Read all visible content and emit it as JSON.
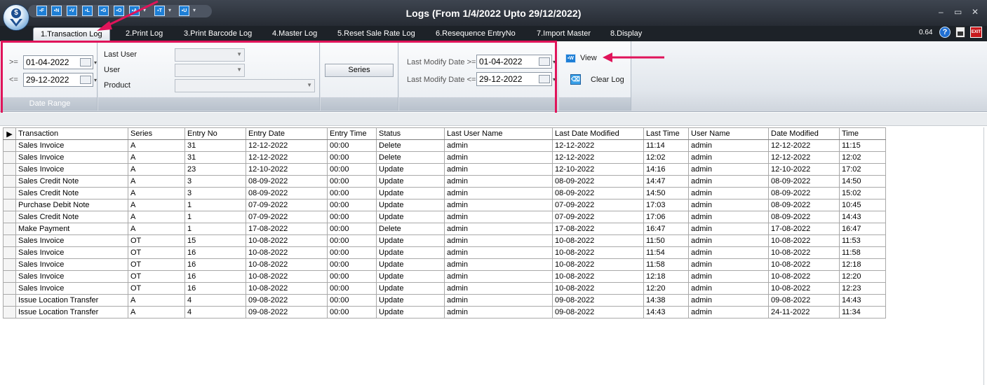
{
  "window": {
    "title": "Logs (From 1/4/2022 Upto 29/12/2022)",
    "minimize": "–",
    "maximize": "▭",
    "close": "✕"
  },
  "quick_access": [
    "▪F",
    "▪N",
    "▪V",
    "▪L",
    "▪G",
    "▪O",
    "▪A",
    "▪T",
    "▪U"
  ],
  "tabs": [
    {
      "label": "1.Transaction Log",
      "active": true
    },
    {
      "label": "2.Print Log"
    },
    {
      "label": "3.Print Barcode Log"
    },
    {
      "label": "4.Master Log"
    },
    {
      "label": "5.Reset Sale Rate Log"
    },
    {
      "label": "6.Resequence EntryNo"
    },
    {
      "label": "7.Import Master"
    },
    {
      "label": "8.Display"
    }
  ],
  "right_tools": {
    "zoom": "0.64",
    "help": "?",
    "exit": "EXIT"
  },
  "ribbon": {
    "date_range": {
      "caption": "Date Range",
      "from_label": ">=",
      "from_value": "01-04-2022",
      "to_label": "<=",
      "to_value": "29-12-2022"
    },
    "filters": {
      "last_user_label": "Last User",
      "user_label": "User",
      "product_label": "Product"
    },
    "series_button": "Series",
    "modify": {
      "from_label": "Last Modify Date >=",
      "from_value": "01-04-2022",
      "to_label": "Last Modify Date <=",
      "to_value": "29-12-2022"
    },
    "actions": {
      "view_label": "View",
      "clear_label": "Clear Log"
    }
  },
  "grid": {
    "columns": [
      "Transaction",
      "Series",
      "Entry No",
      "Entry Date",
      "Entry Time",
      "Status",
      "Last User Name",
      "Last Date Modified",
      "Last Time",
      "User Name",
      "Date Modified",
      "Time"
    ],
    "rows": [
      [
        "Sales Invoice",
        "A",
        "31",
        "12-12-2022",
        "00:00",
        "Delete",
        "admin",
        "12-12-2022",
        "11:14",
        "admin",
        "12-12-2022",
        "11:15"
      ],
      [
        "Sales Invoice",
        "A",
        "31",
        "12-12-2022",
        "00:00",
        "Delete",
        "admin",
        "12-12-2022",
        "12:02",
        "admin",
        "12-12-2022",
        "12:02"
      ],
      [
        "Sales Invoice",
        "A",
        "23",
        "12-10-2022",
        "00:00",
        "Update",
        "admin",
        "12-10-2022",
        "14:16",
        "admin",
        "12-10-2022",
        "17:02"
      ],
      [
        "Sales Credit Note",
        "A",
        "3",
        "08-09-2022",
        "00:00",
        "Update",
        "admin",
        "08-09-2022",
        "14:47",
        "admin",
        "08-09-2022",
        "14:50"
      ],
      [
        "Sales Credit Note",
        "A",
        "3",
        "08-09-2022",
        "00:00",
        "Update",
        "admin",
        "08-09-2022",
        "14:50",
        "admin",
        "08-09-2022",
        "15:02"
      ],
      [
        "Purchase Debit Note",
        "A",
        "1",
        "07-09-2022",
        "00:00",
        "Update",
        "admin",
        "07-09-2022",
        "17:03",
        "admin",
        "08-09-2022",
        "10:45"
      ],
      [
        "Sales Credit Note",
        "A",
        "1",
        "07-09-2022",
        "00:00",
        "Update",
        "admin",
        "07-09-2022",
        "17:06",
        "admin",
        "08-09-2022",
        "14:43"
      ],
      [
        "Make Payment",
        "A",
        "1",
        "17-08-2022",
        "00:00",
        "Delete",
        "admin",
        "17-08-2022",
        "16:47",
        "admin",
        "17-08-2022",
        "16:47"
      ],
      [
        "Sales Invoice",
        "OT",
        "15",
        "10-08-2022",
        "00:00",
        "Update",
        "admin",
        "10-08-2022",
        "11:50",
        "admin",
        "10-08-2022",
        "11:53"
      ],
      [
        "Sales Invoice",
        "OT",
        "16",
        "10-08-2022",
        "00:00",
        "Update",
        "admin",
        "10-08-2022",
        "11:54",
        "admin",
        "10-08-2022",
        "11:58"
      ],
      [
        "Sales Invoice",
        "OT",
        "16",
        "10-08-2022",
        "00:00",
        "Update",
        "admin",
        "10-08-2022",
        "11:58",
        "admin",
        "10-08-2022",
        "12:18"
      ],
      [
        "Sales Invoice",
        "OT",
        "16",
        "10-08-2022",
        "00:00",
        "Update",
        "admin",
        "10-08-2022",
        "12:18",
        "admin",
        "10-08-2022",
        "12:20"
      ],
      [
        "Sales Invoice",
        "OT",
        "16",
        "10-08-2022",
        "00:00",
        "Update",
        "admin",
        "10-08-2022",
        "12:20",
        "admin",
        "10-08-2022",
        "12:23"
      ],
      [
        "Issue Location Transfer",
        "A",
        "4",
        "09-08-2022",
        "00:00",
        "Update",
        "admin",
        "09-08-2022",
        "14:38",
        "admin",
        "09-08-2022",
        "14:43"
      ],
      [
        "Issue Location Transfer",
        "A",
        "4",
        "09-08-2022",
        "00:00",
        "Update",
        "admin",
        "09-08-2022",
        "14:43",
        "admin",
        "24-11-2022",
        "11:34"
      ]
    ]
  },
  "colors": {
    "highlight": "#e0145a",
    "title_bar": "#2f353d",
    "accent_blue": "#1e7fd6"
  }
}
